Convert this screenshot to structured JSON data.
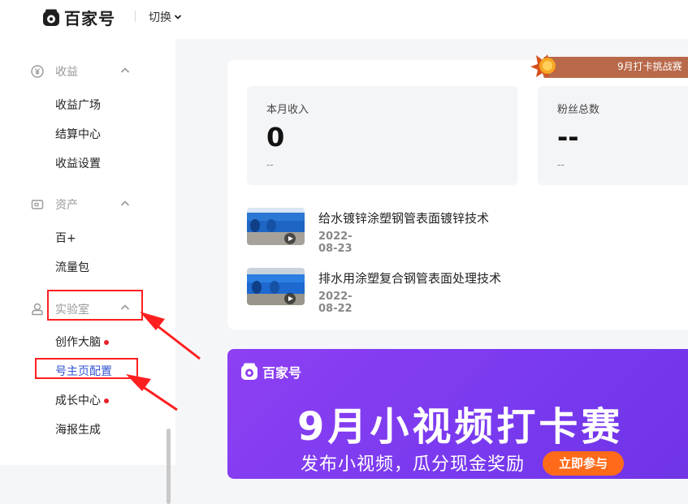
{
  "header": {
    "brand": "百家号",
    "switch_label": "切换"
  },
  "sidebar": {
    "groups": [
      {
        "label": "收益",
        "icon": "yen-circle-icon",
        "items": [
          {
            "label": "收益广场"
          },
          {
            "label": "结算中心"
          },
          {
            "label": "收益设置"
          }
        ]
      },
      {
        "label": "资产",
        "icon": "wallet-icon",
        "items": [
          {
            "label": "百+"
          },
          {
            "label": "流量包"
          }
        ]
      },
      {
        "label": "实验室",
        "icon": "lab-user-icon",
        "items": [
          {
            "label": "创作大脑",
            "badge_dot": true
          },
          {
            "label": "号主页配置",
            "active": true
          },
          {
            "label": "成长中心",
            "badge_dot": true
          },
          {
            "label": "海报生成"
          }
        ]
      }
    ]
  },
  "stats": [
    {
      "label": "本月收入",
      "value": "0",
      "sub": "--"
    },
    {
      "label": "粉丝总数",
      "value": "--",
      "sub": "--"
    }
  ],
  "ribbon": {
    "text": "9月打卡挑战赛"
  },
  "articles": [
    {
      "title": "给水镀锌涂塑钢管表面镀锌技术",
      "date": "2022-08-23"
    },
    {
      "title": "排水用涂塑复合钢管表面处理技术",
      "date": "2022-08-22"
    }
  ],
  "promo": {
    "brand": "百家号",
    "title": "9月小视频打卡赛",
    "subtitle": "发布小视频，瓜分现金奖励",
    "button": "立即参与"
  },
  "colors": {
    "accent": "#3454d1",
    "annotation_red": "#ff1f1f",
    "badge_red": "#e8222a",
    "promo_purple": "#8e3ff2",
    "promo_button": "#ff6a1a"
  }
}
